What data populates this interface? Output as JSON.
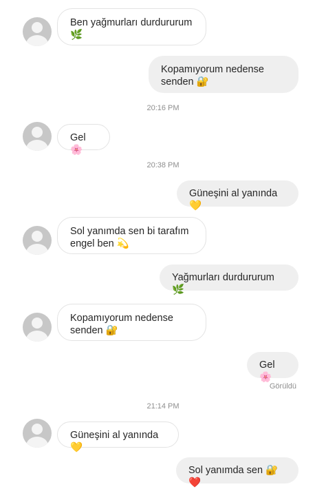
{
  "messages": [
    {
      "from": "them",
      "text": "Ben yağmurları durdururum\n🌿"
    },
    {
      "from": "me",
      "text": "Kopamıyorum nedense\nsenden 🔐"
    },
    {
      "time": "20:16 PM"
    },
    {
      "from": "them",
      "text": "Gel 🌸"
    },
    {
      "time": "20:38 PM"
    },
    {
      "from": "me",
      "text": "Güneşini al yanında💛"
    },
    {
      "from": "them",
      "text": "Sol yanımda sen bi tarafım\nengel ben 💫"
    },
    {
      "from": "me",
      "text": "Yağmurları durdururum🌿"
    },
    {
      "from": "them",
      "text": "Kopamıyorum nedense\nsenden 🔐"
    },
    {
      "from": "me",
      "text": "Gel🌸"
    },
    {
      "status": "Görüldü"
    },
    {
      "time": "21:14 PM"
    },
    {
      "from": "them",
      "text": "Güneşini al yanında💛"
    },
    {
      "from": "me",
      "text": "Sol yanımda sen 🔐❤️"
    }
  ]
}
